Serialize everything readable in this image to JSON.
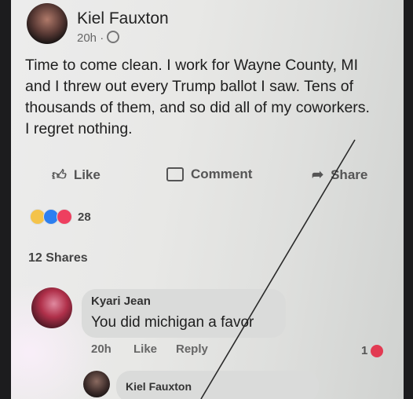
{
  "post": {
    "author": "Kiel Fauxton",
    "time": "20h ·",
    "body": "Time to come clean. I work for Wayne County, MI\nand I threw out every Trump ballot I saw. Tens of\nthousands of them, and so did all of my coworkers.\nI regret nothing.",
    "privacy_icon": "globe-icon"
  },
  "actions": {
    "like_label": "Like",
    "comment_label": "Comment",
    "share_label": "Share"
  },
  "reactions": {
    "count": "28",
    "types": [
      "haha",
      "like",
      "love"
    ],
    "colors": {
      "haha": "#f4c34a",
      "like": "#2d7ff0",
      "love": "#ee3f5f"
    }
  },
  "shares": {
    "label": "12 Shares"
  },
  "comment": {
    "author": "Kyari Jean",
    "text": "You did michigan a favor",
    "time": "20h",
    "like_label": "Like",
    "reply_label": "Reply",
    "reaction_count": "1"
  },
  "reply": {
    "author": "Kiel Fauxton"
  }
}
